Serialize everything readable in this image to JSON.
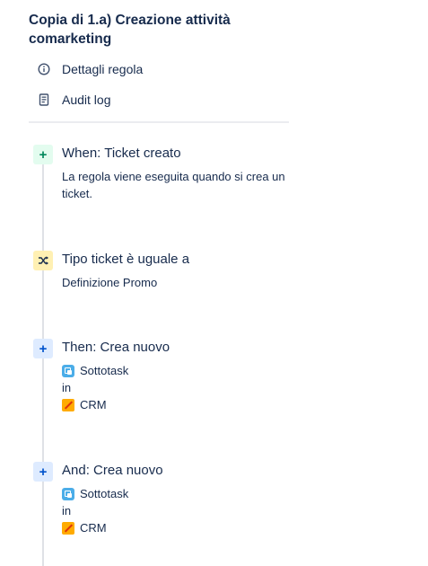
{
  "rule": {
    "title": "Copia di 1.a) Creazione attività comarketing"
  },
  "nav": {
    "details_label": "Dettagli regola",
    "audit_label": "Audit log"
  },
  "steps": [
    {
      "kind": "trigger",
      "badge_icon": "plus-icon",
      "title": "When: Ticket creato",
      "description": "La regola viene eseguita quando si crea un ticket."
    },
    {
      "kind": "condition",
      "badge_icon": "shuffle-icon",
      "title": "Tipo ticket è uguale a",
      "description": "Definizione Promo"
    },
    {
      "kind": "action",
      "badge_icon": "plus-icon",
      "title": "Then: Crea nuovo",
      "issue_type": "Sottotask",
      "connector": "in",
      "project": "CRM"
    },
    {
      "kind": "action",
      "badge_icon": "plus-icon",
      "title": "And: Crea nuovo",
      "issue_type": "Sottotask",
      "connector": "in",
      "project": "CRM"
    }
  ],
  "colors": {
    "trigger_bg": "#e3fcef",
    "trigger_fg": "#00875a",
    "condition_bg": "#fff0b3",
    "action_bg": "#deebff",
    "action_fg": "#0052cc",
    "subtask_icon": "#4bade8",
    "project_icon": "#ffab00"
  }
}
